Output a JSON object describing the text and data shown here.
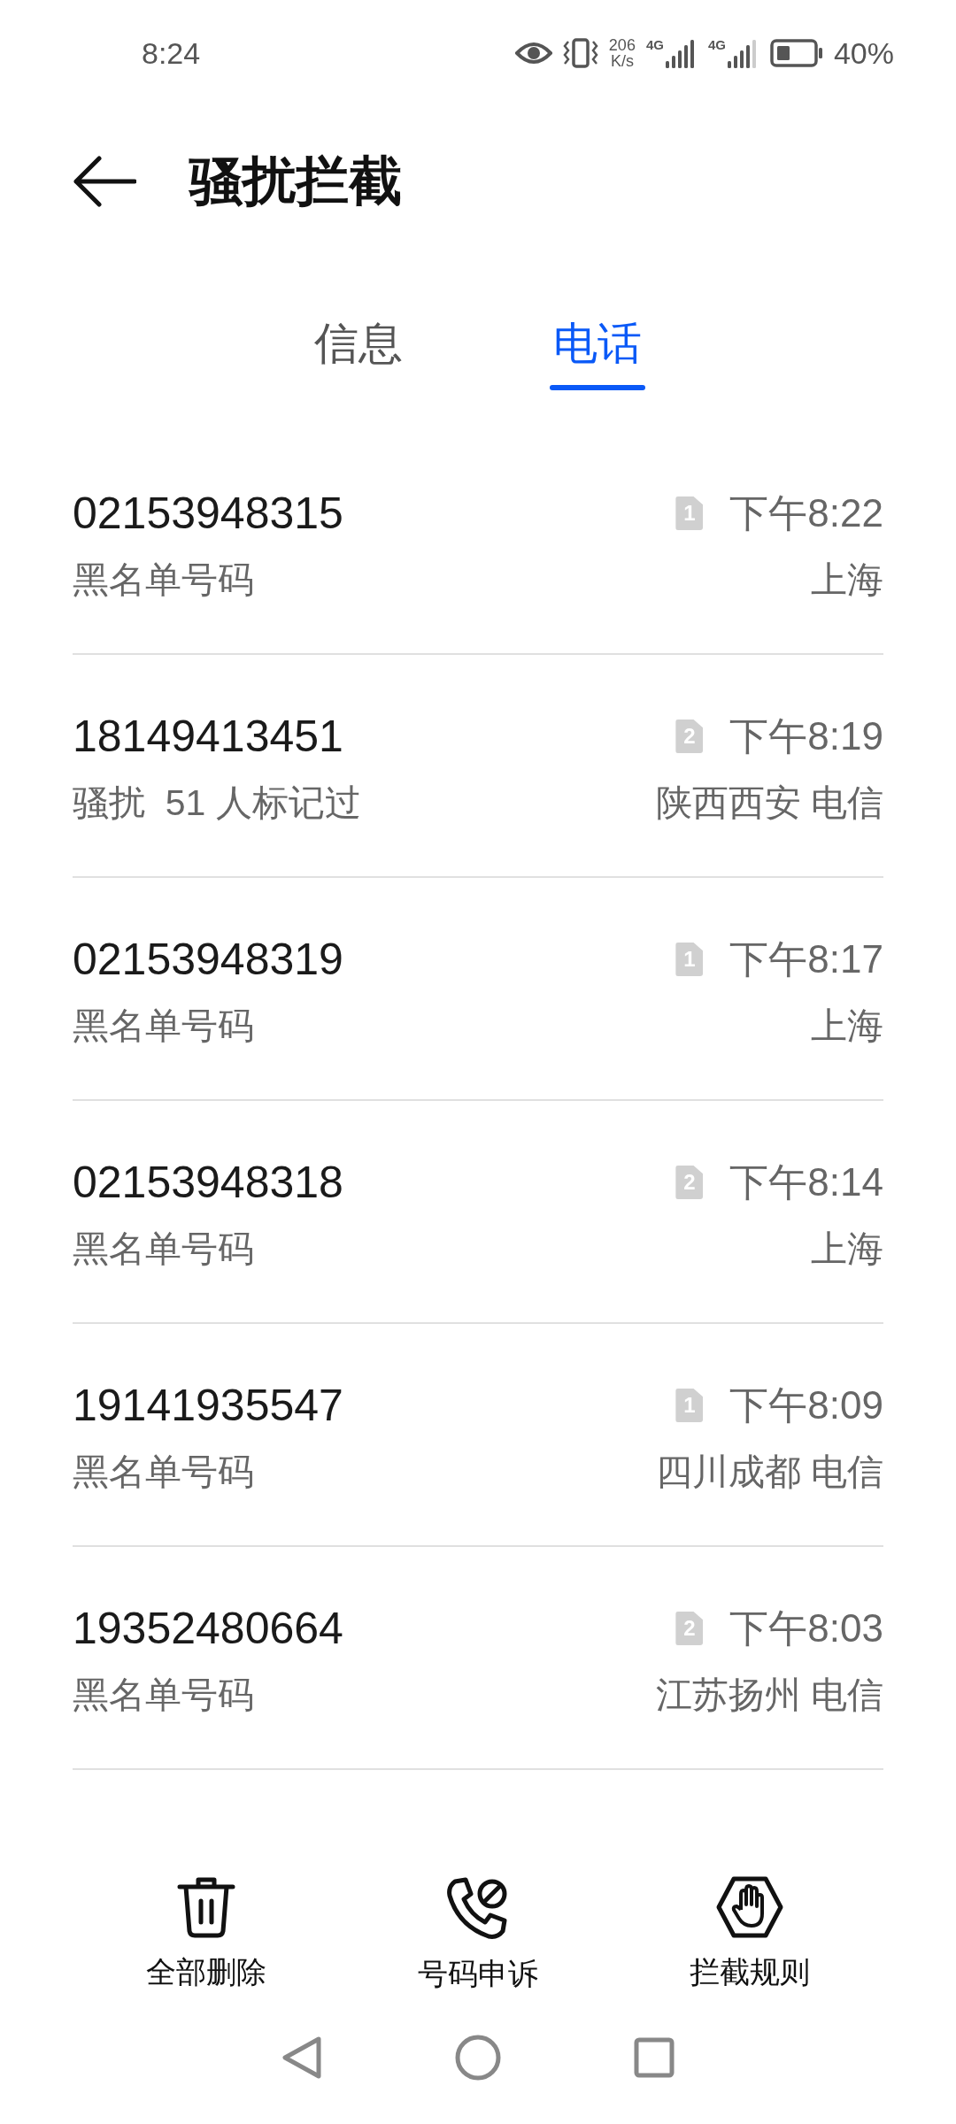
{
  "status_bar": {
    "time": "8:24",
    "speed_value": "206",
    "speed_unit": "K/s",
    "sim1_network": "4G",
    "sim2_network": "4G",
    "battery": "40%"
  },
  "header": {
    "title": "骚扰拦截"
  },
  "tabs": [
    {
      "label": "信息",
      "selected": false
    },
    {
      "label": "电话",
      "selected": true
    }
  ],
  "calls": [
    {
      "number": "02153948315",
      "label": "黑名单号码",
      "sim": "1",
      "time": "下午8:22",
      "location": "上海"
    },
    {
      "number": "18149413451",
      "label": "骚扰  51 人标记过",
      "sim": "2",
      "time": "下午8:19",
      "location": "陕西西安 电信"
    },
    {
      "number": "02153948319",
      "label": "黑名单号码",
      "sim": "1",
      "time": "下午8:17",
      "location": "上海"
    },
    {
      "number": "02153948318",
      "label": "黑名单号码",
      "sim": "2",
      "time": "下午8:14",
      "location": "上海"
    },
    {
      "number": "19141935547",
      "label": "黑名单号码",
      "sim": "1",
      "time": "下午8:09",
      "location": "四川成都 电信"
    },
    {
      "number": "19352480664",
      "label": "黑名单号码",
      "sim": "2",
      "time": "下午8:03",
      "location": "江苏扬州 电信"
    }
  ],
  "actions": [
    {
      "kind": "delete",
      "label": "全部删除"
    },
    {
      "kind": "appeal",
      "label": "号码申诉"
    },
    {
      "kind": "rules",
      "label": "拦截规则"
    }
  ]
}
